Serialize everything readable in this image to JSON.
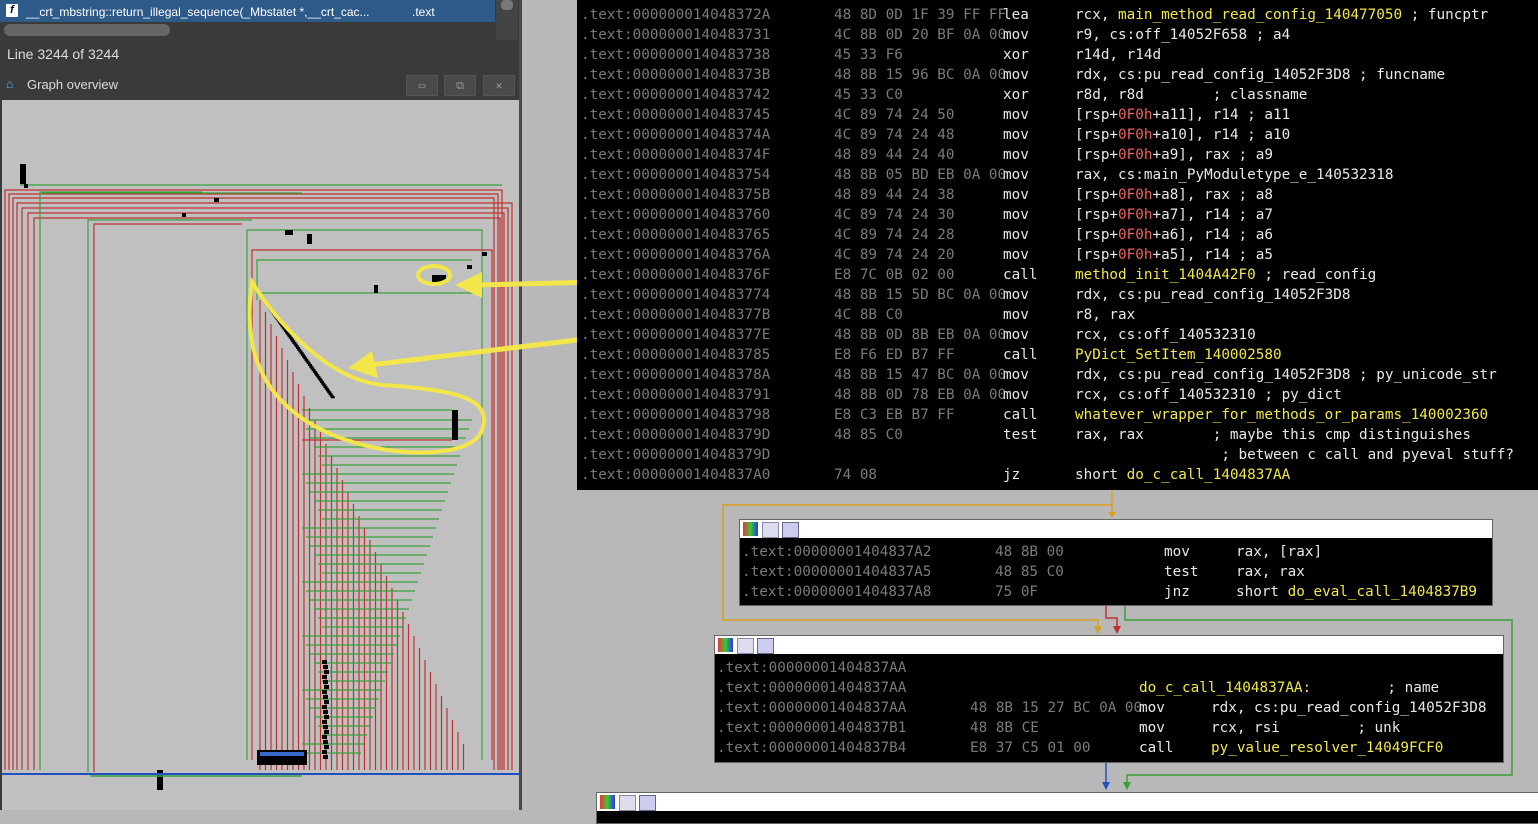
{
  "left_panel": {
    "function_name": "__crt_mbstring::return_illegal_sequence(_Mbstatet *,__crt_cac...",
    "function_segment": ".text",
    "line_info": "Line 3244 of 3244",
    "graph_overview_title": "Graph overview"
  },
  "code_block_main": [
    {
      "addr": ".text:000000014048372A",
      "bytes": "48 8D 0D 1F 39 FF FF",
      "mn": "lea",
      "ops": [
        {
          "t": "rcx, ",
          "c": "c"
        },
        {
          "t": "main_method_read_config_140477050",
          "c": "y"
        },
        {
          "t": " ; funcptr",
          "c": "c"
        }
      ]
    },
    {
      "addr": ".text:0000000140483731",
      "bytes": "4C 8B 0D 20 BF 0A 00",
      "mn": "mov",
      "ops": [
        {
          "t": "r9, cs:off_14052F658 ; a4",
          "c": "c"
        }
      ]
    },
    {
      "addr": ".text:0000000140483738",
      "bytes": "45 33 F6",
      "mn": "xor",
      "ops": [
        {
          "t": "r14d, r14d",
          "c": "c"
        }
      ]
    },
    {
      "addr": ".text:000000014048373B",
      "bytes": "48 8B 15 96 BC 0A 00",
      "mn": "mov",
      "ops": [
        {
          "t": "rdx, cs:pu_read_config_14052F3D8 ; funcname",
          "c": "c"
        }
      ]
    },
    {
      "addr": ".text:0000000140483742",
      "bytes": "45 33 C0",
      "mn": "xor",
      "ops": [
        {
          "t": "r8d, r8d        ; classname",
          "c": "c"
        }
      ]
    },
    {
      "addr": ".text:0000000140483745",
      "bytes": "4C 89 74 24 50",
      "mn": "mov",
      "ops": [
        {
          "t": "[rsp+",
          "c": "c"
        },
        {
          "t": "0F0h",
          "c": "r"
        },
        {
          "t": "+a11], r14 ; a11",
          "c": "c"
        }
      ]
    },
    {
      "addr": ".text:000000014048374A",
      "bytes": "4C 89 74 24 48",
      "mn": "mov",
      "ops": [
        {
          "t": "[rsp+",
          "c": "c"
        },
        {
          "t": "0F0h",
          "c": "r"
        },
        {
          "t": "+a10], r14 ; a10",
          "c": "c"
        }
      ]
    },
    {
      "addr": ".text:000000014048374F",
      "bytes": "48 89 44 24 40",
      "mn": "mov",
      "ops": [
        {
          "t": "[rsp+",
          "c": "c"
        },
        {
          "t": "0F0h",
          "c": "r"
        },
        {
          "t": "+a9], rax ; a9",
          "c": "c"
        }
      ]
    },
    {
      "addr": ".text:0000000140483754",
      "bytes": "48 8B 05 BD EB 0A 00",
      "mn": "mov",
      "ops": [
        {
          "t": "rax, cs:main_PyModuletype_e_140532318",
          "c": "c"
        }
      ]
    },
    {
      "addr": ".text:000000014048375B",
      "bytes": "48 89 44 24 38",
      "mn": "mov",
      "ops": [
        {
          "t": "[rsp+",
          "c": "c"
        },
        {
          "t": "0F0h",
          "c": "r"
        },
        {
          "t": "+a8], rax ; a8",
          "c": "c"
        }
      ]
    },
    {
      "addr": ".text:0000000140483760",
      "bytes": "4C 89 74 24 30",
      "mn": "mov",
      "ops": [
        {
          "t": "[rsp+",
          "c": "c"
        },
        {
          "t": "0F0h",
          "c": "r"
        },
        {
          "t": "+a7], r14 ; a7",
          "c": "c"
        }
      ]
    },
    {
      "addr": ".text:0000000140483765",
      "bytes": "4C 89 74 24 28",
      "mn": "mov",
      "ops": [
        {
          "t": "[rsp+",
          "c": "c"
        },
        {
          "t": "0F0h",
          "c": "r"
        },
        {
          "t": "+a6], r14 ; a6",
          "c": "c"
        }
      ]
    },
    {
      "addr": ".text:000000014048376A",
      "bytes": "4C 89 74 24 20",
      "mn": "mov",
      "ops": [
        {
          "t": "[rsp+",
          "c": "c"
        },
        {
          "t": "0F0h",
          "c": "r"
        },
        {
          "t": "+a5], r14 ; a5",
          "c": "c"
        }
      ]
    },
    {
      "addr": ".text:000000014048376F",
      "bytes": "E8 7C 0B 02 00",
      "mn": "call",
      "ops": [
        {
          "t": "method_init_1404A42F0",
          "c": "y"
        },
        {
          "t": " ; read_config",
          "c": "c"
        }
      ]
    },
    {
      "addr": ".text:0000000140483774",
      "bytes": "48 8B 15 5D BC 0A 00",
      "mn": "mov",
      "ops": [
        {
          "t": "rdx, cs:pu_read_config_14052F3D8",
          "c": "c"
        }
      ]
    },
    {
      "addr": ".text:000000014048377B",
      "bytes": "4C 8B C0",
      "mn": "mov",
      "ops": [
        {
          "t": "r8, rax",
          "c": "c"
        }
      ]
    },
    {
      "addr": ".text:000000014048377E",
      "bytes": "48 8B 0D 8B EB 0A 00",
      "mn": "mov",
      "ops": [
        {
          "t": "rcx, cs:off_140532310",
          "c": "c"
        }
      ]
    },
    {
      "addr": ".text:0000000140483785",
      "bytes": "E8 F6 ED B7 FF",
      "mn": "call",
      "ops": [
        {
          "t": "PyDict_SetItem_140002580",
          "c": "y"
        }
      ]
    },
    {
      "addr": ".text:000000014048378A",
      "bytes": "48 8B 15 47 BC 0A 00",
      "mn": "mov",
      "ops": [
        {
          "t": "rdx, cs:pu_read_config_14052F3D8 ; py_unicode_str",
          "c": "c"
        }
      ]
    },
    {
      "addr": ".text:0000000140483791",
      "bytes": "48 8B 0D 78 EB 0A 00",
      "mn": "mov",
      "ops": [
        {
          "t": "rcx, cs:off_140532310 ; py_dict",
          "c": "c"
        }
      ]
    },
    {
      "addr": ".text:0000000140483798",
      "bytes": "E8 C3 EB B7 FF",
      "mn": "call",
      "ops": [
        {
          "t": "whatever_wrapper_for_methods_or_params_140002360",
          "c": "y"
        }
      ]
    },
    {
      "addr": ".text:000000014048379D",
      "bytes": "48 85 C0",
      "mn": "test",
      "ops": [
        {
          "t": "rax, rax        ; maybe this cmp distinguishes",
          "c": "c"
        }
      ]
    },
    {
      "addr": ".text:000000014048379D",
      "bytes": "",
      "mn": "",
      "ops": [
        {
          "t": "                 ; between c call and pyeval stuff?",
          "c": "c"
        }
      ]
    },
    {
      "addr": ".text:00000001404837A0",
      "bytes": "74 08",
      "mn": "jz",
      "ops": [
        {
          "t": "short ",
          "c": "c"
        },
        {
          "t": "do_c_call_1404837AA",
          "c": "y"
        }
      ]
    }
  ],
  "code_block_2": [
    {
      "addr": ".text:00000001404837A2",
      "bytes": "48 8B 00",
      "mn": "mov",
      "ops": [
        {
          "t": "rax, [rax]",
          "c": "c"
        }
      ]
    },
    {
      "addr": ".text:00000001404837A5",
      "bytes": "48 85 C0",
      "mn": "test",
      "ops": [
        {
          "t": "rax, rax",
          "c": "c"
        }
      ]
    },
    {
      "addr": ".text:00000001404837A8",
      "bytes": "75 0F",
      "mn": "jnz",
      "ops": [
        {
          "t": "short ",
          "c": "c"
        },
        {
          "t": "do_eval_call_1404837B9",
          "c": "y"
        }
      ]
    }
  ],
  "code_block_3": [
    {
      "addr": ".text:00000001404837AA",
      "bytes": "",
      "mn": "",
      "ops": []
    },
    {
      "addr": ".text:00000001404837AA",
      "bytes": "",
      "mn": "",
      "label": "do_c_call_1404837AA:",
      "ops": [
        {
          "t": "    ; name",
          "c": "c"
        }
      ]
    },
    {
      "addr": ".text:00000001404837AA",
      "bytes": "48 8B 15 27 BC 0A 00",
      "mn": "mov",
      "ops": [
        {
          "t": "rdx, cs:pu_read_config_14052F3D8",
          "c": "c"
        }
      ]
    },
    {
      "addr": ".text:00000001404837B1",
      "bytes": "48 8B CE",
      "mn": "mov",
      "ops": [
        {
          "t": "rcx, rsi         ; unk",
          "c": "c"
        }
      ]
    },
    {
      "addr": ".text:00000001404837B4",
      "bytes": "E8 37 C5 01 00",
      "mn": "call",
      "ops": [
        {
          "t": "py_value_resolver_14049FCF0",
          "c": "y"
        }
      ]
    }
  ],
  "colors": {
    "highlight_yellow": "#f2e64a",
    "edge_green": "#3aa03a",
    "edge_red": "#c03030",
    "edge_blue": "#2050c0"
  }
}
